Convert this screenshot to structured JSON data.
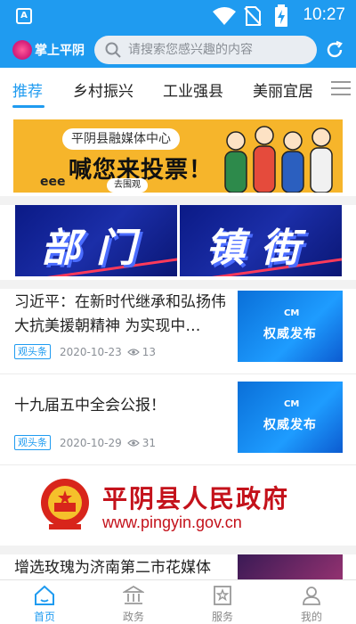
{
  "status_bar": {
    "time": "10:27",
    "app_badge": "A"
  },
  "header": {
    "app_name": "掌上平阴",
    "search_placeholder": "请搜索您感兴趣的内容"
  },
  "tabs": [
    {
      "label": "推荐",
      "active": true
    },
    {
      "label": "乡村振兴",
      "active": false
    },
    {
      "label": "工业强县",
      "active": false
    },
    {
      "label": "美丽宜居",
      "active": false
    }
  ],
  "feed": {
    "vote_banner": {
      "org": "平阴县融媒体中心",
      "headline": "喊您来投票！",
      "button": "去围观",
      "deco": "eee"
    },
    "dual_banner": {
      "left": "部门",
      "right": "镇街"
    },
    "articles": [
      {
        "title": "习近平：在新时代继承和弘扬伟大抗美援朝精神 为实现中…",
        "tag": "观头条",
        "date": "2020-10-23",
        "views": "13",
        "thumb_text": "权威发布",
        "thumb_logo": "CM"
      },
      {
        "title": "十九届五中全会公报！",
        "tag": "观头条",
        "date": "2020-10-29",
        "views": "31",
        "thumb_text": "权威发布",
        "thumb_logo": "CM"
      },
      {
        "title": "增选玫瑰为济南第二市花媒体"
      }
    ],
    "gov_banner": {
      "name": "平阴县人民政府",
      "url": "www.pingyin.gov.cn"
    }
  },
  "bottom_nav": [
    {
      "label": "首页",
      "icon": "home-icon",
      "active": true
    },
    {
      "label": "政务",
      "icon": "government-icon",
      "active": false
    },
    {
      "label": "服务",
      "icon": "service-icon",
      "active": false
    },
    {
      "label": "我的",
      "icon": "profile-icon",
      "active": false
    }
  ],
  "colors": {
    "accent": "#1f9bf0",
    "gov_red": "#c4121b",
    "vote_yellow": "#f6b52b"
  }
}
